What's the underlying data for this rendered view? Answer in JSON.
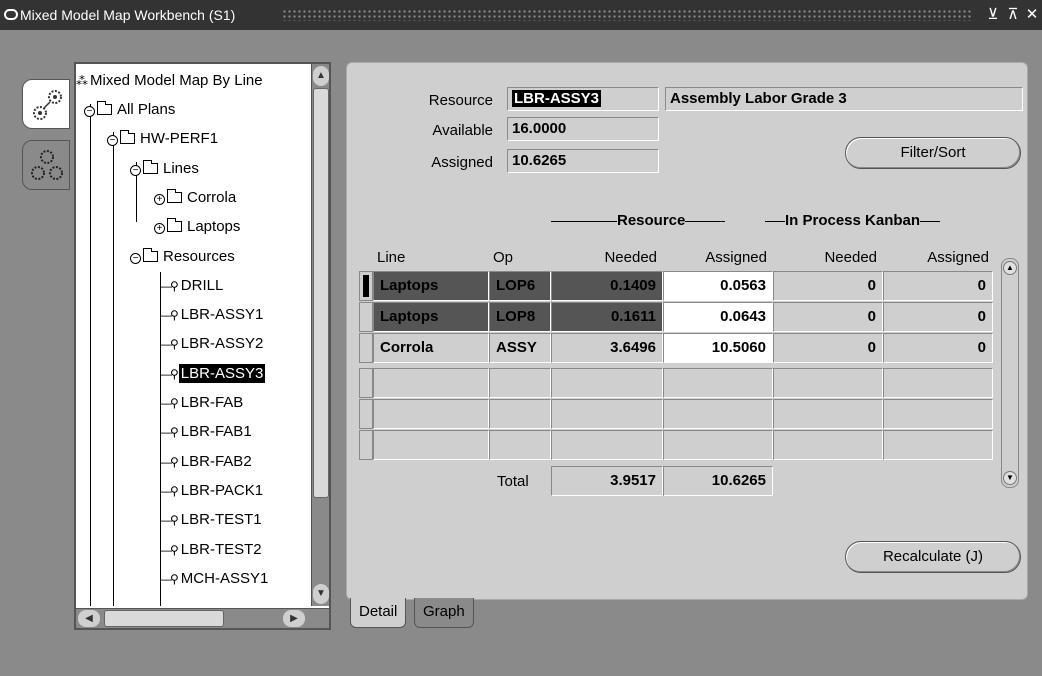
{
  "window": {
    "title": "Mixed Model Map Workbench (S1)",
    "controls": {
      "minimize": "⊻",
      "maximize": "⊼",
      "close": "✕"
    }
  },
  "side_tabs": [
    {
      "name": "mixed-model-map-tab",
      "icon": "gears-icon",
      "active": true
    },
    {
      "name": "plans-tab",
      "icon": "gear-cluster-icon",
      "active": false
    }
  ],
  "tree": {
    "root": "Mixed Model Map By Line",
    "all_plans": "All Plans",
    "plan": "HW-PERF1",
    "lines_folder": "Lines",
    "lines": [
      "Corrola",
      "Laptops"
    ],
    "resources_folder": "Resources",
    "resources": [
      "DRILL",
      "LBR-ASSY1",
      "LBR-ASSY2",
      "LBR-ASSY3",
      "LBR-FAB",
      "LBR-FAB1",
      "LBR-FAB2",
      "LBR-PACK1",
      "LBR-TEST1",
      "LBR-TEST2",
      "MCH-ASSY1"
    ],
    "selected_resource": "LBR-ASSY3"
  },
  "detail": {
    "resource_label": "Resource",
    "resource_value": "LBR-ASSY3",
    "resource_desc": "Assembly Labor Grade 3",
    "available_label": "Available",
    "available_value": "16.0000",
    "assigned_label": "Assigned",
    "assigned_value": "10.6265",
    "filter_sort_button": "Filter/Sort",
    "section_resource": "Resource",
    "section_kanban": "In Process Kanban",
    "columns": {
      "line": "Line",
      "op": "Op",
      "needed": "Needed",
      "assigned": "Assigned",
      "kanban_needed": "Needed",
      "kanban_assigned": "Assigned"
    },
    "rows": [
      {
        "line": "Laptops",
        "op": "LOP6",
        "needed": "0.1409",
        "assigned": "0.0563",
        "kanban_needed": "0",
        "kanban_assigned": "0",
        "current": true,
        "highlight": true
      },
      {
        "line": "Laptops",
        "op": "LOP8",
        "needed": "0.1611",
        "assigned": "0.0643",
        "kanban_needed": "0",
        "kanban_assigned": "0",
        "current": false,
        "highlight": true
      },
      {
        "line": "Corrola",
        "op": "ASSY",
        "needed": "3.6496",
        "assigned": "10.5060",
        "kanban_needed": "0",
        "kanban_assigned": "0",
        "current": false,
        "highlight": false
      },
      {
        "line": "",
        "op": "",
        "needed": "",
        "assigned": "",
        "kanban_needed": "",
        "kanban_assigned": "",
        "current": false,
        "highlight": false
      },
      {
        "line": "",
        "op": "",
        "needed": "",
        "assigned": "",
        "kanban_needed": "",
        "kanban_assigned": "",
        "current": false,
        "highlight": false
      },
      {
        "line": "",
        "op": "",
        "needed": "",
        "assigned": "",
        "kanban_needed": "",
        "kanban_assigned": "",
        "current": false,
        "highlight": false
      }
    ],
    "total_label": "Total",
    "total_needed": "3.9517",
    "total_assigned": "10.6265",
    "recalculate_button": "Recalculate (J)"
  },
  "bottom_tabs": {
    "detail": "Detail",
    "graph": "Graph"
  }
}
